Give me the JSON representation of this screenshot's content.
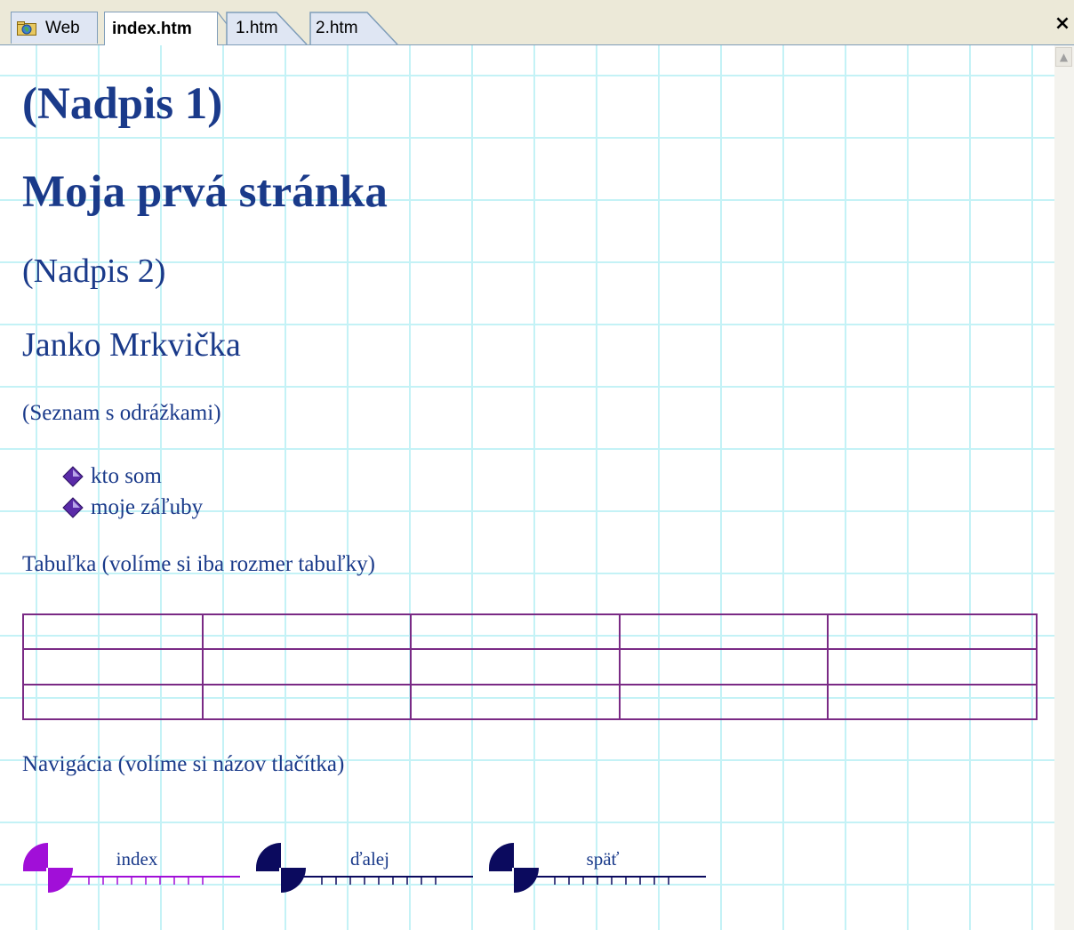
{
  "tabs": [
    {
      "label": "Web"
    },
    {
      "label": "index.htm"
    },
    {
      "label": "1.htm"
    },
    {
      "label": "2.htm"
    }
  ],
  "close_label": "×",
  "headings": {
    "h1_placeholder": "(Nadpis 1)",
    "h1_title": "Moja prvá stránka",
    "h2_placeholder": "(Nadpis 2)",
    "h2_name": "Janko Mrkvička"
  },
  "bullet_list": {
    "caption": "(Seznam s odrážkami)",
    "items": [
      {
        "label": "kto som"
      },
      {
        "label": "moje záľuby"
      }
    ]
  },
  "table": {
    "caption": "Tabuľka (volíme si iba rozmer tabuľky)",
    "rows": 3,
    "columns": 5
  },
  "navigation": {
    "caption": "Navigácia (volíme si názov tlačítka)",
    "buttons": [
      {
        "label": "index",
        "color": "#a10fd8"
      },
      {
        "label": "ďalej",
        "color": "#0b0a5e"
      },
      {
        "label": "späť",
        "color": "#0b0a5e"
      }
    ]
  },
  "colors": {
    "text": "#1a3a8a",
    "bullet": "#4a2a9a",
    "table_border": "#1f3c78",
    "table_inner": "#7a2a85",
    "grid_lines": "#c4f2f6"
  }
}
